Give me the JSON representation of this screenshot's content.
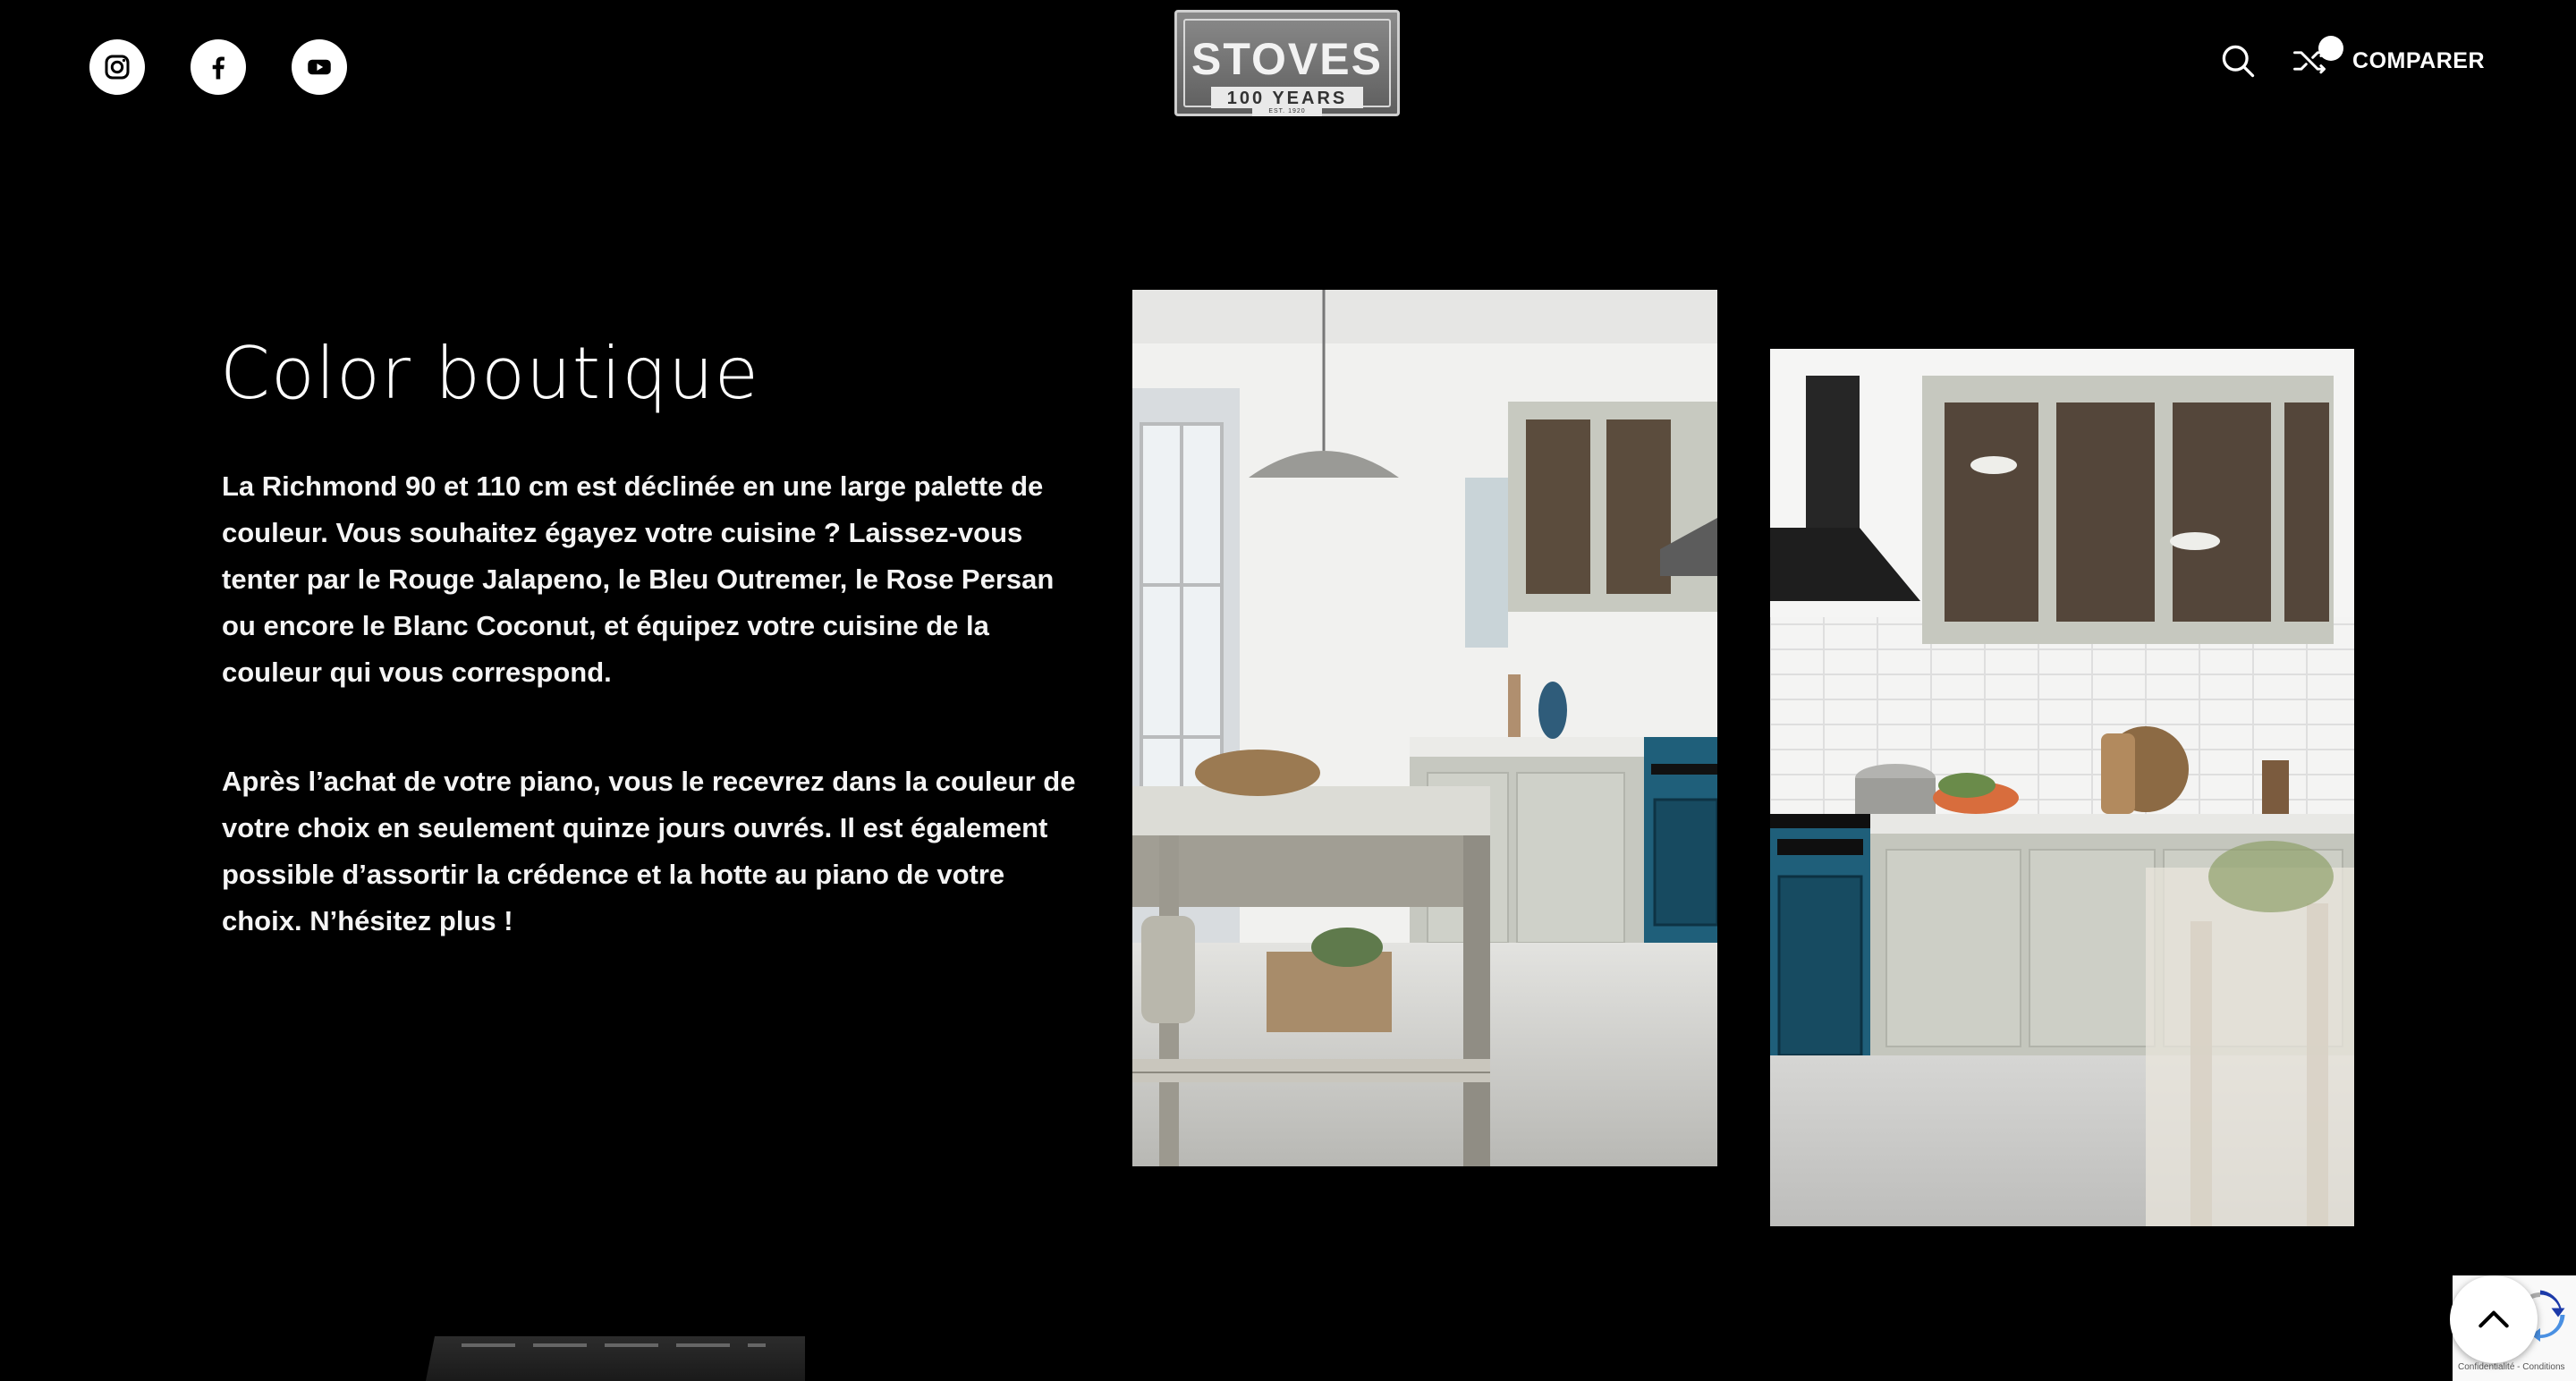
{
  "header": {
    "social": [
      {
        "name": "instagram-icon"
      },
      {
        "name": "facebook-icon"
      },
      {
        "name": "youtube-icon"
      }
    ],
    "logo": {
      "word": "STOVES",
      "years": "100 YEARS",
      "est": "EST. 1920"
    },
    "search_icon": "search-icon",
    "compare": {
      "icon": "shuffle-icon",
      "count": "",
      "label": "COMPARER"
    }
  },
  "section": {
    "title": "Color boutique",
    "paragraph_1": "La Richmond 90 et 110 cm est déclinée en une large palette de couleur. Vous souhaitez égayez votre cuisine ? Laissez-vous tenter par le Rouge Jalapeno, le Bleu Outremer, le Rose Persan ou encore le Blanc Coconut, et équipez votre cuisine de la couleur qui vous correspond.",
    "paragraph_2": "Après l’achat de votre piano, vous le recevrez dans la couleur de votre choix en seulement quinze jours ouvrés. Il est également possible d’assortir la crédence et la hotte au piano de votre choix. N’hésitez plus !"
  },
  "recaptcha": {
    "text": "Confidentialité - Conditions"
  },
  "colors": {
    "background": "#000000",
    "text": "#ffffff",
    "teal_stove": "#1f5f7a",
    "cabinet_sage": "#c9cbc2"
  }
}
